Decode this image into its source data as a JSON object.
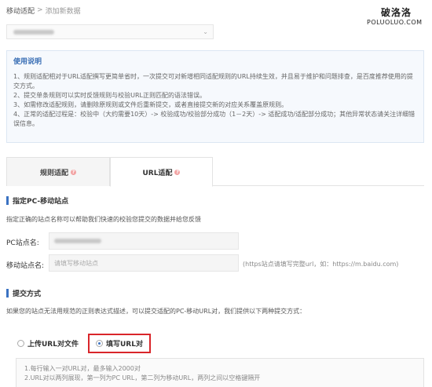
{
  "breadcrumb": {
    "parent": "移动适配",
    "separator": ">",
    "current": "添加新数据"
  },
  "watermark": {
    "chinese": "破洛洛",
    "english": "POLUOLUO.COM"
  },
  "site_select": {
    "chevron": "⌄"
  },
  "instructions": {
    "title": "使用说明",
    "lines": [
      "1、规则适配相对于URL适配撰写更简单省时，一次提交可对新增相同适配规则的URL持续生效，并且易于维护和问题排查，是百度推荐使用的提交方式。",
      "2、提交单条规则可以实时反馈规则与校验URL正则匹配的语法错误。",
      "3、如需修改适配规则，请删除原规则或文件后重新提交，或者直接提交新的对应关系覆盖原规则。",
      "4、正常的适配过程是：校验中（大约需要10天）-> 校验成功/校验部分成功（1－2天）-> 适配成功/适配部分成功；其他异常状态请关注详细错误信息。"
    ]
  },
  "tabs": [
    {
      "label": "规则适配",
      "badge": "?"
    },
    {
      "label": "URL适配",
      "badge": "?"
    }
  ],
  "pc_section": {
    "title": "指定PC-移动站点",
    "desc": "指定正确的站点名称可以帮助我们快速的校验您提交的数据并给您反馈",
    "pc_label": "PC站点名:",
    "mobile_label": "移动站点名:",
    "mobile_placeholder": "请填写移动站点",
    "mobile_hint": "(https站点请填写完整url，如：https://m.baidu.com)"
  },
  "submit_section": {
    "title": "提交方式",
    "desc": "如果您的站点无法用规范的正则表达式描述，可以提交适配的PC-移动URL对，我们提供以下两种提交方式：",
    "option_upload": "上传URL对文件",
    "option_fill": "填写URL对",
    "selected": "填写URL对"
  },
  "note": {
    "lines": [
      "1.每行输入一对URL对，最多输入2000对",
      "2.URL对以两列展现，第一列为PC URL，第二列为移动URL，两列之间以空格键隔开"
    ]
  },
  "colors": {
    "accent": "#3a72c2",
    "highlight_border": "#d9252a",
    "instruction_bg": "#f6f9fd"
  }
}
